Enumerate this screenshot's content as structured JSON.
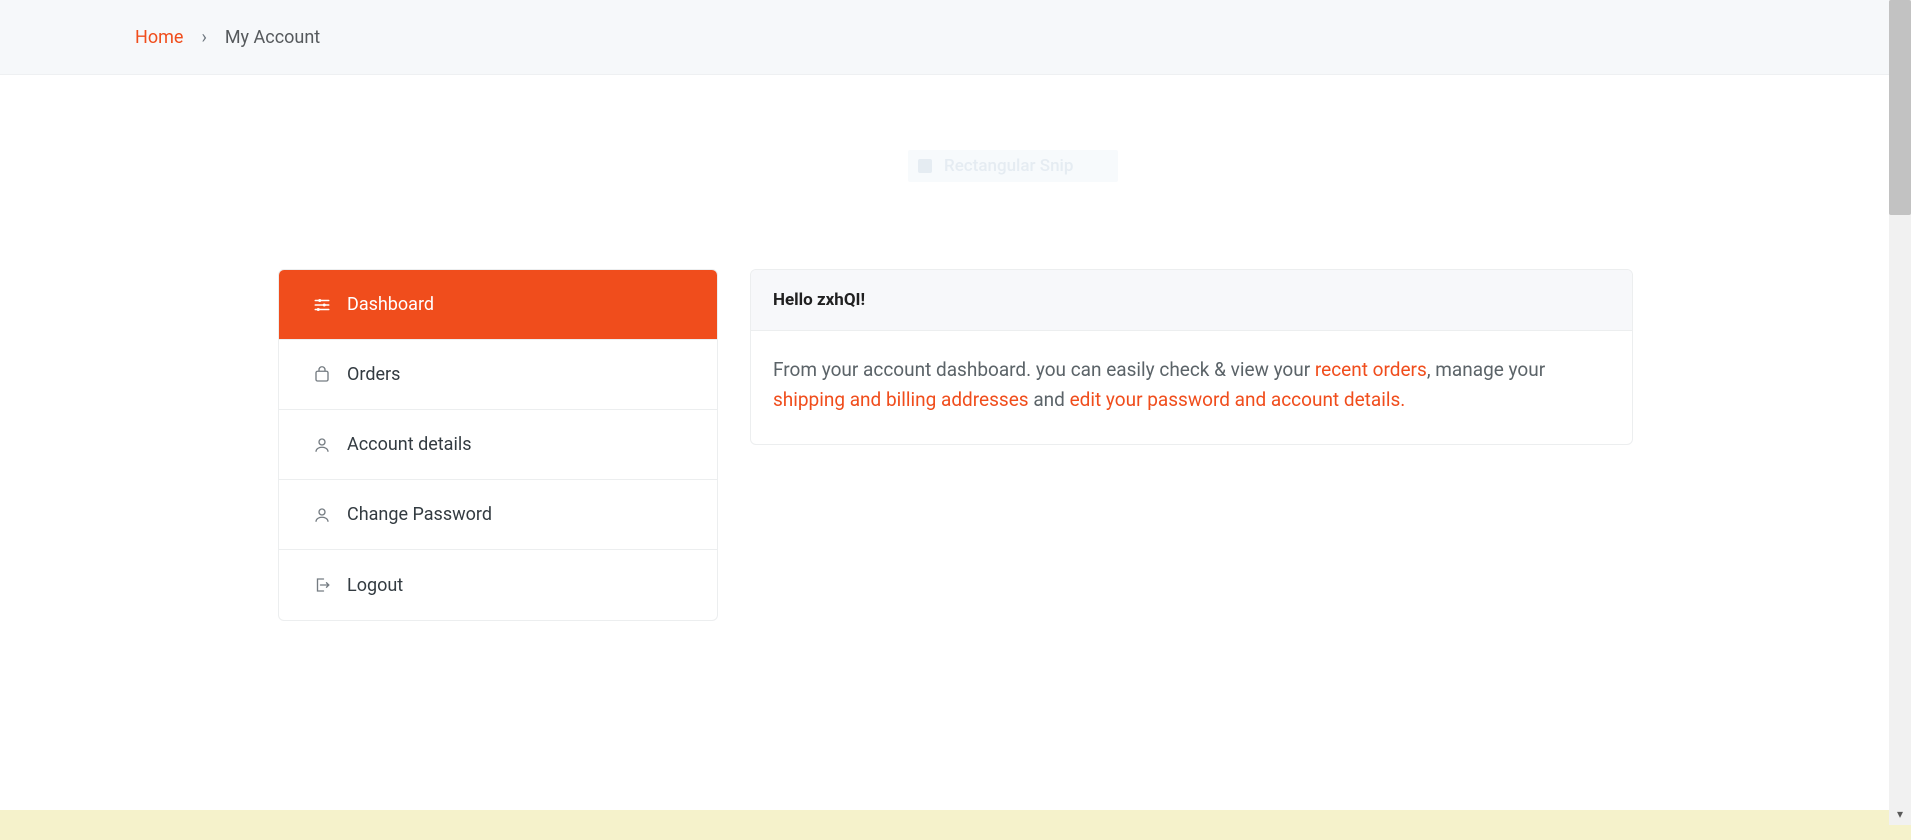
{
  "breadcrumb": {
    "home": "Home",
    "separator": "›",
    "current": "My Account"
  },
  "snip": {
    "label": "Rectangular Snip"
  },
  "sidebar": {
    "items": [
      {
        "label": "Dashboard",
        "icon": "sliders-icon",
        "active": true
      },
      {
        "label": "Orders",
        "icon": "bag-icon",
        "active": false
      },
      {
        "label": "Account details",
        "icon": "user-icon",
        "active": false
      },
      {
        "label": "Change Password",
        "icon": "user-icon",
        "active": false
      },
      {
        "label": "Logout",
        "icon": "logout-icon",
        "active": false
      }
    ]
  },
  "panel": {
    "greeting": "Hello zxhQI!",
    "body": {
      "pre": "From your account dashboard. you can easily check & view your ",
      "link_orders": "recent orders",
      "mid1": ", manage your ",
      "link_addresses": "shipping and billing addresses",
      "mid2": " and ",
      "link_details": "edit your password and account details."
    }
  },
  "colors": {
    "accent": "#f04d1c",
    "breadcrumb_bg": "#f6f8fa",
    "panel_header_bg": "#f7f8fa",
    "footer_strip": "#f5f2cb"
  }
}
